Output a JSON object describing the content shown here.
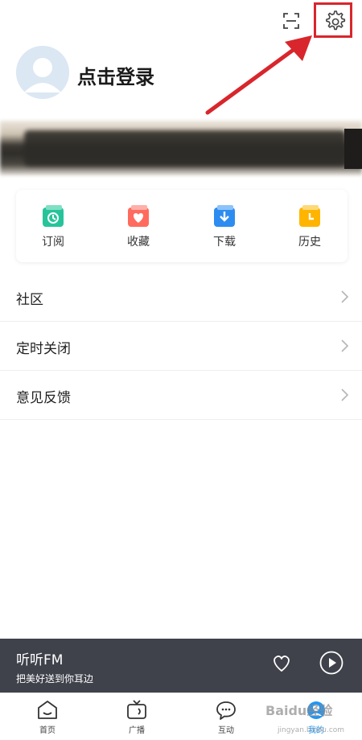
{
  "profile": {
    "login_label": "点击登录"
  },
  "quick_grid": [
    {
      "label": "订阅",
      "icon": "subscribe-icon",
      "color": "#27c49b"
    },
    {
      "label": "收藏",
      "icon": "favorite-icon",
      "color": "#ff6b5e"
    },
    {
      "label": "下载",
      "icon": "download-icon",
      "color": "#2d8cf0"
    },
    {
      "label": "历史",
      "icon": "history-icon",
      "color": "#ffb400"
    }
  ],
  "menu": [
    {
      "label": "社区"
    },
    {
      "label": "定时关闭"
    },
    {
      "label": "意见反馈"
    }
  ],
  "player": {
    "title": "听听FM",
    "subtitle": "把美好送到你耳边"
  },
  "bottom_nav": [
    {
      "label": "首页",
      "icon": "home-icon"
    },
    {
      "label": "广播",
      "icon": "tv-icon"
    },
    {
      "label": "互动",
      "icon": "chat-icon"
    },
    {
      "label": "我的",
      "icon": "profile-icon",
      "active": true
    }
  ],
  "watermark": {
    "text": "Baidu经验",
    "sub": "jingyan.baidu.com"
  },
  "colors": {
    "accent": "#2196f3",
    "player_bg": "#3f424b",
    "annotation": "#d8262c"
  }
}
